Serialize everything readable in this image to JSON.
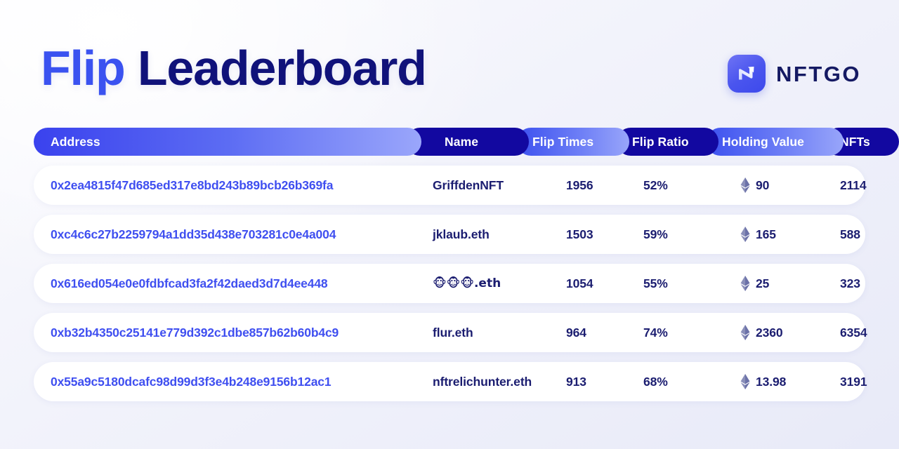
{
  "header": {
    "title_accent": "Flip",
    "title_rest": " Leaderboard",
    "brand_name": "NFTGO",
    "brand_icon": "nftgo-logo-icon",
    "accent_color": "#3a52f0",
    "title_color": "#10127a"
  },
  "table": {
    "columns": [
      {
        "key": "address",
        "label": "Address"
      },
      {
        "key": "name",
        "label": "Name"
      },
      {
        "key": "flip_times",
        "label": "Flip Times"
      },
      {
        "key": "flip_ratio",
        "label": "Flip Ratio"
      },
      {
        "key": "holding_value",
        "label": "Holding Value"
      },
      {
        "key": "nfts",
        "label": "NFTs"
      }
    ],
    "currency_icon": "ethereum-icon",
    "rows": [
      {
        "address": "0x2ea4815f47d685ed317e8bd243b89bcb26b369fa",
        "name": "GriffdenNFT",
        "flip_times": "1956",
        "flip_ratio": "52%",
        "holding_value": "90",
        "nfts": "2114"
      },
      {
        "address": "0xc4c6c27b2259794a1dd35d438e703281c0e4a004",
        "name": "jklaub.eth",
        "flip_times": "1503",
        "flip_ratio": "59%",
        "holding_value": "165",
        "nfts": "588"
      },
      {
        "address": "0x616ed054e0e0fdbfcad3fa2f42daed3d7d4ee448",
        "name": "🐵🐵🐵.eth",
        "flip_times": "1054",
        "flip_ratio": "55%",
        "holding_value": "25",
        "nfts": "323"
      },
      {
        "address": "0xb32b4350c25141e779d392c1dbe857b62b60b4c9",
        "name": "flur.eth",
        "flip_times": "964",
        "flip_ratio": "74%",
        "holding_value": "2360",
        "nfts": "6354"
      },
      {
        "address": "0x55a9c5180dcafc98d99d3f3e4b248e9156b12ac1",
        "name": "nftrelichunter.eth",
        "flip_times": "913",
        "flip_ratio": "68%",
        "holding_value": "13.98",
        "nfts": "3191"
      }
    ]
  }
}
